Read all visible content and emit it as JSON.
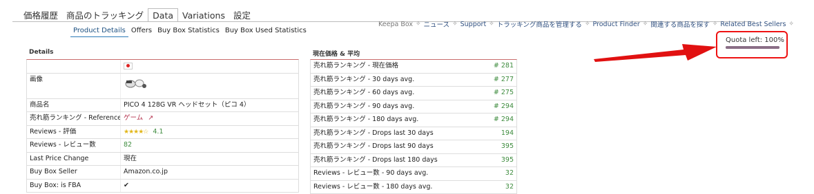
{
  "top_tabs": [
    "価格履歴",
    "商品のトラッキング",
    "Data",
    "Variations",
    "設定"
  ],
  "active_top_tab": "Data",
  "sub_tabs": [
    "Product Details",
    "Offers",
    "Buy Box Statistics",
    "Buy Box Used Statistics"
  ],
  "active_sub_tab": "Product Details",
  "right_nav": [
    "Keepa Box",
    "ニュース",
    "Support",
    "トラッキング商品を管理する",
    "Product Finder",
    "関連する商品を探す",
    "Related Best Sellers"
  ],
  "quota": {
    "label": "Quota left: 100%",
    "fraction": 1.0
  },
  "details": {
    "title": "Details",
    "rows": [
      {
        "key": "",
        "value": "",
        "flag": "jp-flag"
      },
      {
        "key": "画像",
        "value": "",
        "image": "vr-headset-thumbnail"
      },
      {
        "key": "商品名",
        "value": "PICO 4 128G VR ヘッドセット（ピコ 4）"
      },
      {
        "key": "売れ筋ランキング - Reference",
        "value": "ゲーム",
        "link": true,
        "icon": "external-link-icon"
      },
      {
        "key": "Reviews - 評価",
        "value": "4.1",
        "stars": 4.1
      },
      {
        "key": "Reviews - レビュー数",
        "value": "82",
        "green": true
      },
      {
        "key": "Last Price Change",
        "value": "現在"
      },
      {
        "key": "Buy Box Seller",
        "value": "Amazon.co.jp"
      },
      {
        "key": "Buy Box: is FBA",
        "value": "",
        "check": true
      }
    ]
  },
  "prices": {
    "title": "現在価格 & 平均",
    "rows": [
      {
        "label": "売れ筋ランキング - 現在価格",
        "value": "# 281"
      },
      {
        "label": "売れ筋ランキング - 30 days avg.",
        "value": "# 277"
      },
      {
        "label": "売れ筋ランキング - 60 days avg.",
        "value": "# 275"
      },
      {
        "label": "売れ筋ランキング - 90 days avg.",
        "value": "# 294"
      },
      {
        "label": "売れ筋ランキング - 180 days avg.",
        "value": "# 294"
      },
      {
        "label": "売れ筋ランキング - Drops last 30 days",
        "value": "194"
      },
      {
        "label": "売れ筋ランキング - Drops last 90 days",
        "value": "395"
      },
      {
        "label": "売れ筋ランキング - Drops last 180 days",
        "value": "395"
      },
      {
        "label": "Reviews - レビュー数 - 90 days avg.",
        "value": "32"
      },
      {
        "label": "Reviews - レビュー数 - 180 days avg.",
        "value": "32"
      }
    ]
  },
  "colors": {
    "accent": "#2a7ab7",
    "link": "#b5334e",
    "value_green": "#3d8b3d",
    "highlight": "#e11111"
  }
}
